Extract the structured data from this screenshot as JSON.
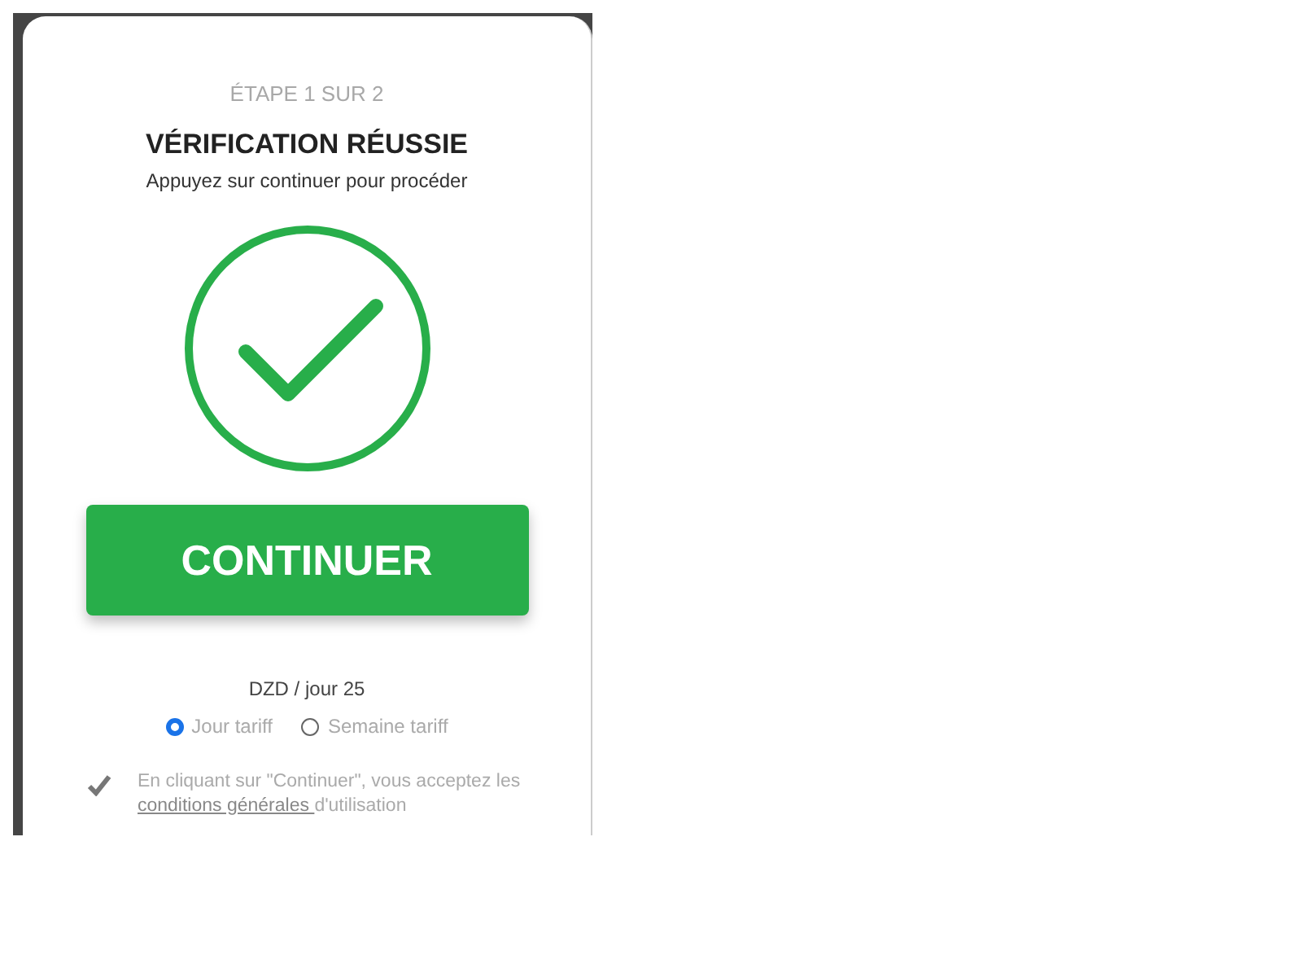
{
  "step": "ÉTAPE 1 SUR 2",
  "title": "VÉRIFICATION RÉUSSIE",
  "subtitle": "Appuyez sur continuer pour procéder",
  "button": "CONTINUER",
  "price": "DZD / jour 25",
  "rates": [
    {
      "label": "Jour tariff",
      "selected": true
    },
    {
      "label": "Semaine tariff",
      "selected": false
    }
  ],
  "terms": {
    "before": "En cliquant sur \"Continuer\", vous acceptez les ",
    "link": "conditions générales ",
    "after": "d'utilisation"
  }
}
